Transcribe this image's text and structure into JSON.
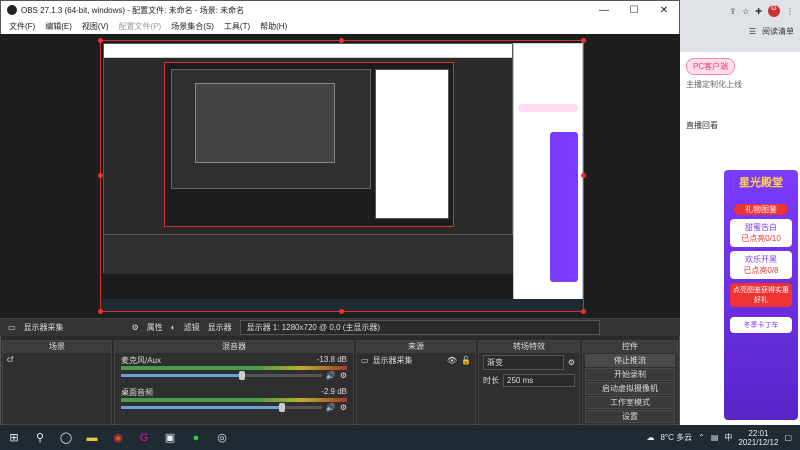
{
  "window": {
    "title": "OBS 27.1.3 (64-bit, windows) - 配置文件: 未命名 - 场景: 未命名",
    "controls": {
      "minimize": "—",
      "maximize": "☐",
      "close": "✕"
    }
  },
  "menu": [
    "文件(F)",
    "编辑(E)",
    "视图(V)",
    "配置文件(P)",
    "场景集合(S)",
    "工具(T)",
    "帮助(H)"
  ],
  "source_toolbar": {
    "source_name": "显示器采集",
    "properties": "属性",
    "filters": "滤镜",
    "display_label": "显示器",
    "display_value": "显示器 1: 1280x720 @ 0,0 (主显示器)"
  },
  "docks": {
    "scenes": {
      "title": "场景",
      "items": [
        "cf"
      ]
    },
    "mixer": {
      "title": "混音器",
      "channels": [
        {
          "name": "麦克风/Aux",
          "db": "-13.8 dB",
          "level": 0.6
        },
        {
          "name": "桌面音频",
          "db": "-2.9 dB",
          "level": 0.8
        }
      ]
    },
    "sources": {
      "title": "来源",
      "items": [
        "显示器采集"
      ]
    },
    "transitions": {
      "title": "转场特效",
      "type": "渐变",
      "duration_label": "时长",
      "duration": "250 ms"
    },
    "controls": {
      "title": "控件",
      "buttons": [
        "停止推流",
        "开始录制",
        "启动虚拟摄像机",
        "工作室模式",
        "设置"
      ]
    }
  },
  "browser": {
    "reading_list": "阅读清单",
    "badge": "PC客户端",
    "sub": "主播定制化上线",
    "banner1": "星光殿堂",
    "gift": "礼物图鉴",
    "gift1": "甜蜜告白",
    "gift1_count": "已点亮0/10",
    "gift2": "欢乐开黑",
    "gift2_count": "已点亮0/8",
    "link": "点亮图鉴获得实惠好礼",
    "card": "冬季卡丁车",
    "replay": "直播回看"
  },
  "taskbar": {
    "weather": "8°C 多云",
    "lang": "中",
    "time": "22:01",
    "date": "2021/12/12"
  },
  "colors": {
    "accent": "#e33",
    "obs_bg": "#2a2a2a",
    "taskbar": "#1f2a33"
  }
}
